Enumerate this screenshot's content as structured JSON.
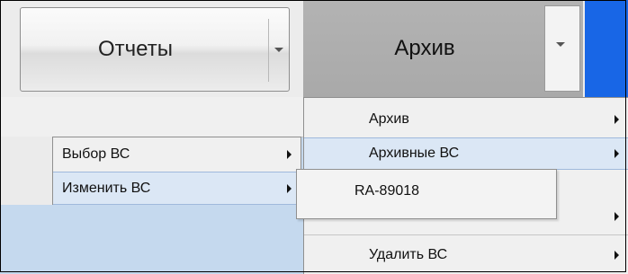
{
  "toolbar": {
    "reports_label": "Отчеты",
    "archive_label": "Архив"
  },
  "menu_reports": {
    "items": [
      {
        "label": "Выбор ВС",
        "has_submenu": true,
        "highlighted": false
      },
      {
        "label": "Изменить ВС",
        "has_submenu": true,
        "highlighted": true
      }
    ]
  },
  "menu_aircraft": {
    "items": [
      {
        "label": "RA-89018"
      }
    ]
  },
  "menu_archive": {
    "items": [
      {
        "label": "Архив",
        "has_submenu": true,
        "highlighted": false
      },
      {
        "label": "Архивные ВС",
        "has_submenu": true,
        "highlighted": true
      },
      {
        "label": "",
        "has_submenu": true,
        "highlighted": false
      },
      {
        "label": "Удалить ВС",
        "has_submenu": true,
        "highlighted": false
      }
    ]
  },
  "colors": {
    "accent_blue": "#1866e6",
    "highlight": "#dbe7f5",
    "background_blue": "#c5d9ee"
  }
}
